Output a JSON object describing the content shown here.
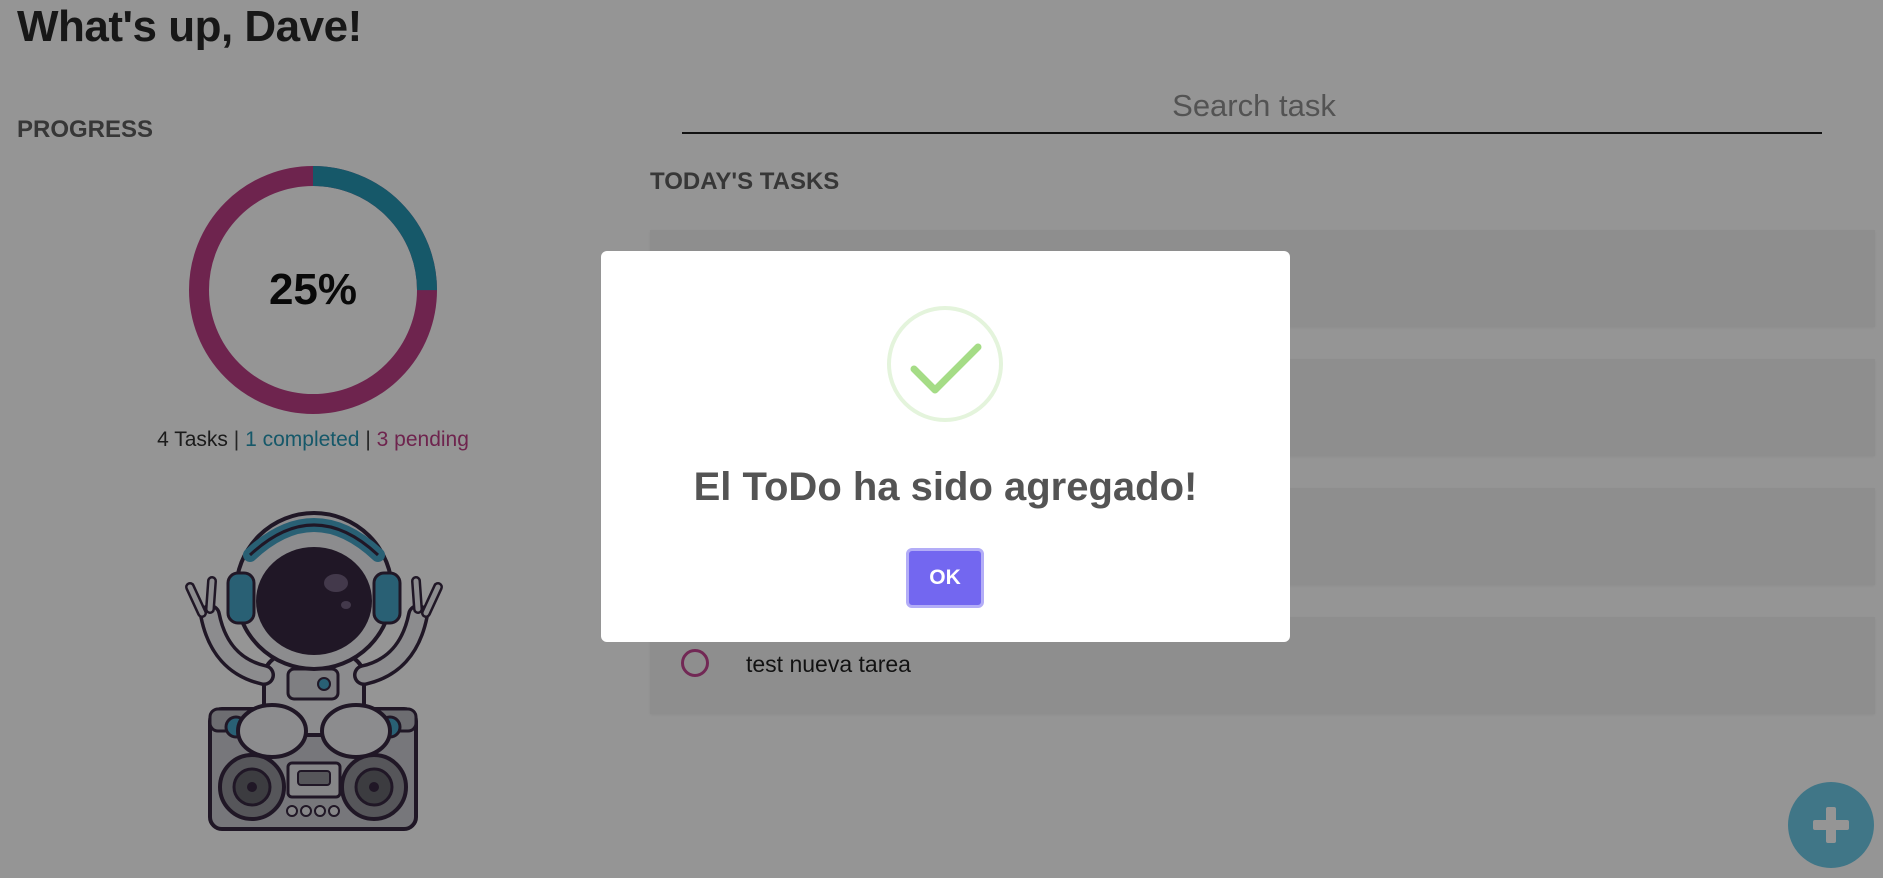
{
  "header": {
    "greeting": "What's up, Dave!"
  },
  "progress": {
    "title": "PROGRESS",
    "percent_label": "25%",
    "completed_fraction": 0.25,
    "total_label": "4 Tasks",
    "separator": "|",
    "completed_label": "1 completed",
    "pending_label": "3 pending",
    "colors": {
      "completed": "#1890b0",
      "pending": "#b8327e"
    }
  },
  "search": {
    "placeholder": "Search task",
    "value": ""
  },
  "tasks": {
    "title": "TODAY'S TASKS",
    "items": [
      {
        "label": "",
        "done": false
      },
      {
        "label": "",
        "done": false
      },
      {
        "label": "",
        "done": false
      },
      {
        "label": "test nueva tarea",
        "done": false
      }
    ]
  },
  "fab": {
    "icon": "plus-icon",
    "color": "#64c7e6"
  },
  "modal": {
    "icon": "success-check-icon",
    "title": "El ToDo ha sido agregado!",
    "ok_label": "OK",
    "ok_color": "#7367f0"
  }
}
